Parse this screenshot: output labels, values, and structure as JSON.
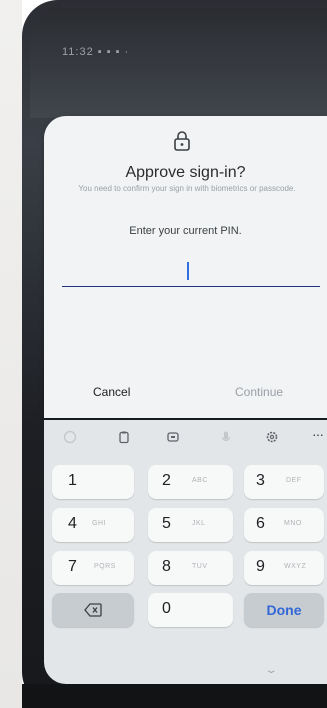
{
  "status_bar": {
    "time": "11:32 ▪ ▪ ▪ ·"
  },
  "dialog": {
    "icon": "lock-icon",
    "title": "Approve sign-in?",
    "subtitle": "You need to confirm your sign in with biometrics or passcode.",
    "prompt": "Enter your current PIN.",
    "pin_value": "",
    "cancel_label": "Cancel",
    "continue_label": "Continue"
  },
  "keyboard": {
    "toolbar": [
      "emoji-icon",
      "clipboard-icon",
      "sticker-icon",
      "microphone-icon",
      "settings-icon",
      "more-icon"
    ],
    "more_label": "···",
    "keys": [
      {
        "num": "1",
        "letters": ""
      },
      {
        "num": "2",
        "letters": "ABC"
      },
      {
        "num": "3",
        "letters": "DEF"
      },
      {
        "num": "4",
        "letters": "GHI"
      },
      {
        "num": "5",
        "letters": "JKL"
      },
      {
        "num": "6",
        "letters": "MNO"
      },
      {
        "num": "7",
        "letters": "PQRS"
      },
      {
        "num": "8",
        "letters": "TUV"
      },
      {
        "num": "9",
        "letters": "WXYZ"
      },
      {
        "num": "0",
        "letters": ""
      }
    ],
    "done_label": "Done",
    "hide_icon": "chevron-down-icon"
  },
  "colors": {
    "accent": "#3367d6",
    "input_underline": "#23337b",
    "dialog_bg": "#f1f3f4",
    "keyboard_bg": "#e3e6e8"
  }
}
